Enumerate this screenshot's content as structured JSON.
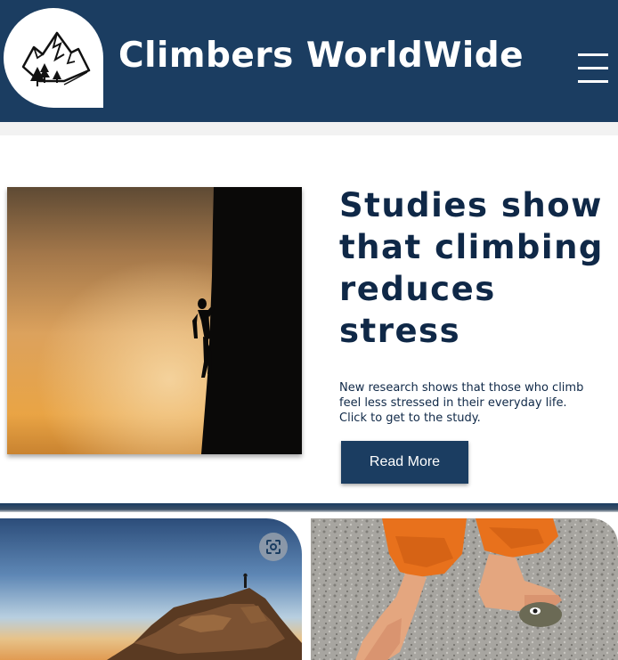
{
  "header": {
    "brand_title": "Climbers WorldWide",
    "logo_icon": "mountain-trees-icon",
    "menu_icon": "hamburger-menu-icon",
    "background_color": "#1b3d61"
  },
  "featured": {
    "headline": "Studies show that climbing reduces stress",
    "body": "New research shows that those who climb feel less stressed in their everyday life. Click to get to the study.",
    "button_label": "Read More",
    "image_subject": "climber-silhouette-sunset",
    "text_color": "#0f2847"
  },
  "cards": [
    {
      "image_subject": "summit-rock-at-dusk",
      "overlay_icon": "visual-search-icon"
    },
    {
      "image_subject": "bare-feet-on-granite-boulder"
    }
  ]
}
